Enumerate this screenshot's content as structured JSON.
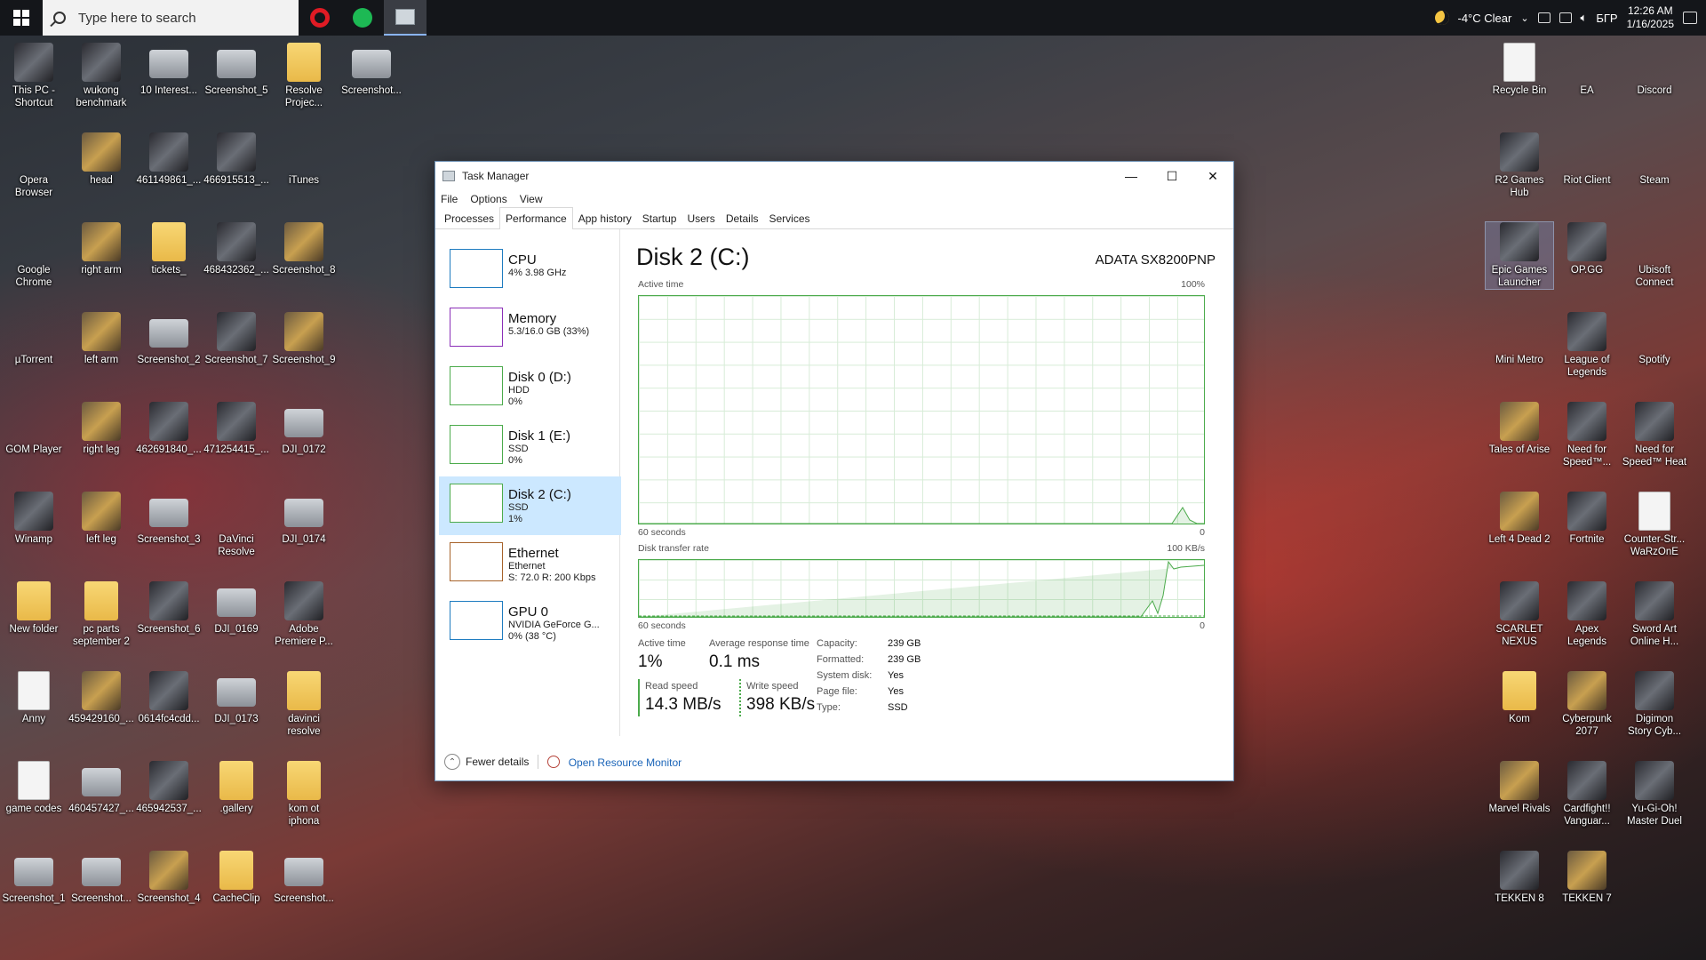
{
  "taskbar": {
    "search_placeholder": "Type here to search",
    "weather": "-4°C  Clear",
    "language": "БГР",
    "time": "12:26 AM",
    "date": "1/16/2025"
  },
  "desktop_left": [
    {
      "label": "This PC -\nShortcut",
      "icon": "pc-icon",
      "style": "dark"
    },
    {
      "label": "wukong\nbenchmark",
      "icon": "image-icon",
      "style": "dark"
    },
    {
      "label": "10 Interest...",
      "icon": "screenshot-icon",
      "style": "shot"
    },
    {
      "label": "Screenshot_5",
      "icon": "screenshot-icon",
      "style": "shot"
    },
    {
      "label": "Resolve\nProjec...",
      "icon": "folder-icon",
      "style": "folder"
    },
    {
      "label": "Screenshot...",
      "icon": "screenshot-icon",
      "style": "shot"
    },
    {
      "label": "Opera\nBrowser",
      "icon": "opera-icon",
      "style": "circle"
    },
    {
      "label": "head",
      "icon": "image-icon",
      "style": "photo"
    },
    {
      "label": "461149861_...",
      "icon": "image-icon",
      "style": "dark"
    },
    {
      "label": "466915513_...",
      "icon": "image-icon",
      "style": "dark"
    },
    {
      "label": "iTunes",
      "icon": "itunes-icon",
      "style": "circle"
    },
    {
      "label": "Google\nChrome",
      "icon": "chrome-icon",
      "style": "circle"
    },
    {
      "label": "right arm",
      "icon": "image-icon",
      "style": "photo"
    },
    {
      "label": "tickets_",
      "icon": "folder-icon",
      "style": "folder"
    },
    {
      "label": "468432362_...",
      "icon": "image-icon",
      "style": "dark"
    },
    {
      "label": "Screenshot_8",
      "icon": "image-icon",
      "style": "photo"
    },
    {
      "label": "µTorrent",
      "icon": "utorrent-icon",
      "style": "circle"
    },
    {
      "label": "left arm",
      "icon": "image-icon",
      "style": "photo"
    },
    {
      "label": "Screenshot_2",
      "icon": "screenshot-icon",
      "style": "shot"
    },
    {
      "label": "Screenshot_7",
      "icon": "image-icon",
      "style": "dark"
    },
    {
      "label": "Screenshot_9",
      "icon": "image-icon",
      "style": "photo"
    },
    {
      "label": "GOM Player",
      "icon": "gom-icon",
      "style": "circle"
    },
    {
      "label": "right leg",
      "icon": "image-icon",
      "style": "photo"
    },
    {
      "label": "462691840_...",
      "icon": "image-icon",
      "style": "dark"
    },
    {
      "label": "471254415_...",
      "icon": "image-icon",
      "style": "dark"
    },
    {
      "label": "DJI_0172",
      "icon": "screenshot-icon",
      "style": "shot"
    },
    {
      "label": "Winamp",
      "icon": "winamp-icon",
      "style": "dark"
    },
    {
      "label": "left leg",
      "icon": "image-icon",
      "style": "photo"
    },
    {
      "label": "Screenshot_3",
      "icon": "screenshot-icon",
      "style": "shot"
    },
    {
      "label": "DaVinci\nResolve",
      "icon": "davinci-icon",
      "style": "circle"
    },
    {
      "label": "DJI_0174",
      "icon": "screenshot-icon",
      "style": "shot"
    },
    {
      "label": "New folder",
      "icon": "folder-icon",
      "style": "folder"
    },
    {
      "label": "pc parts\nseptember 2",
      "icon": "folder-icon",
      "style": "folder"
    },
    {
      "label": "Screenshot_6",
      "icon": "image-icon",
      "style": "dark"
    },
    {
      "label": "DJI_0169",
      "icon": "screenshot-icon",
      "style": "shot"
    },
    {
      "label": "Adobe\nPremiere P...",
      "icon": "premiere-icon",
      "style": "dark"
    },
    {
      "label": "Anny",
      "icon": "pdf-icon",
      "style": "doc"
    },
    {
      "label": "459429160_...",
      "icon": "image-icon",
      "style": "photo"
    },
    {
      "label": "0614fc4cdd...",
      "icon": "image-icon",
      "style": "dark"
    },
    {
      "label": "DJI_0173",
      "icon": "screenshot-icon",
      "style": "shot"
    },
    {
      "label": "davinci\nresolve",
      "icon": "folder-icon",
      "style": "folder"
    },
    {
      "label": "game codes",
      "icon": "document-icon",
      "style": "doc"
    },
    {
      "label": "460457427_...",
      "icon": "screenshot-icon",
      "style": "shot"
    },
    {
      "label": "465942537_...",
      "icon": "image-icon",
      "style": "dark"
    },
    {
      "label": ".gallery",
      "icon": "folder-icon",
      "style": "folder"
    },
    {
      "label": "kom ot\niphona",
      "icon": "folder-icon",
      "style": "folder"
    },
    {
      "label": "Screenshot_1",
      "icon": "screenshot-icon",
      "style": "shot"
    },
    {
      "label": "Screenshot...",
      "icon": "screenshot-icon",
      "style": "shot"
    },
    {
      "label": "Screenshot_4",
      "icon": "image-icon",
      "style": "photo"
    },
    {
      "label": "CacheClip",
      "icon": "folder-icon",
      "style": "folder"
    },
    {
      "label": "Screenshot...",
      "icon": "screenshot-icon",
      "style": "shot"
    }
  ],
  "desktop_right": [
    {
      "label": "Recycle Bin",
      "icon": "recycle-bin-icon",
      "style": "doc"
    },
    {
      "label": "EA",
      "icon": "ea-icon",
      "style": "circle"
    },
    {
      "label": "Discord",
      "icon": "discord-icon",
      "style": "circle"
    },
    {
      "label": "R2 Games\nHub",
      "icon": "r2-games-icon",
      "style": "dark"
    },
    {
      "label": "Riot Client",
      "icon": "riot-icon",
      "style": "circle"
    },
    {
      "label": "Steam",
      "icon": "steam-icon",
      "style": "circle"
    },
    {
      "label": "Epic Games\nLauncher",
      "icon": "epic-icon",
      "style": "dark"
    },
    {
      "label": "OP.GG",
      "icon": "opgg-icon",
      "style": "dark"
    },
    {
      "label": "Ubisoft\nConnect",
      "icon": "ubisoft-icon",
      "style": "circle"
    },
    {
      "label": "Mini Metro",
      "icon": "minimetro-icon",
      "style": "circle"
    },
    {
      "label": "League of\nLegends",
      "icon": "lol-icon",
      "style": "dark"
    },
    {
      "label": "Spotify",
      "icon": "spotify-icon",
      "style": "circle"
    },
    {
      "label": "Tales of Arise",
      "icon": "game-icon",
      "style": "photo"
    },
    {
      "label": "Need for\nSpeed™...",
      "icon": "game-icon",
      "style": "dark"
    },
    {
      "label": "Need for\nSpeed™ Heat",
      "icon": "game-icon",
      "style": "dark"
    },
    {
      "label": "Left 4 Dead 2",
      "icon": "game-icon",
      "style": "photo"
    },
    {
      "label": "Fortnite",
      "icon": "fortnite-icon",
      "style": "dark"
    },
    {
      "label": "Counter-Str...\nWaRzOnE",
      "icon": "game-icon",
      "style": "doc"
    },
    {
      "label": "SCARLET\nNEXUS",
      "icon": "game-icon",
      "style": "dark"
    },
    {
      "label": "Apex\nLegends",
      "icon": "apex-icon",
      "style": "dark"
    },
    {
      "label": "Sword Art\nOnline H...",
      "icon": "game-icon",
      "style": "dark"
    },
    {
      "label": "Kom",
      "icon": "folder-icon",
      "style": "folder"
    },
    {
      "label": "Cyberpunk\n2077",
      "icon": "game-icon",
      "style": "photo"
    },
    {
      "label": "Digimon\nStory Cyb...",
      "icon": "game-icon",
      "style": "dark"
    },
    {
      "label": "Marvel Rivals",
      "icon": "game-icon",
      "style": "photo"
    },
    {
      "label": "Cardfight!!\nVanguar...",
      "icon": "game-icon",
      "style": "dark"
    },
    {
      "label": "Yu-Gi-Oh!\nMaster Duel",
      "icon": "game-icon",
      "style": "dark"
    },
    {
      "label": "TEKKEN 8",
      "icon": "game-icon",
      "style": "dark"
    },
    {
      "label": "TEKKEN 7",
      "icon": "game-icon",
      "style": "photo"
    }
  ],
  "taskmanager": {
    "title": "Task Manager",
    "menu": [
      "File",
      "Options",
      "View"
    ],
    "tabs": [
      "Processes",
      "Performance",
      "App history",
      "Startup",
      "Users",
      "Details",
      "Services"
    ],
    "active_tab": "Performance",
    "sidebar": [
      {
        "name": "CPU",
        "sub1": "4%  3.98 GHz",
        "sub2": "",
        "color": "#1e7cc0"
      },
      {
        "name": "Memory",
        "sub1": "5.3/16.0 GB (33%)",
        "sub2": "",
        "color": "#8b2fb8"
      },
      {
        "name": "Disk 0 (D:)",
        "sub1": "HDD",
        "sub2": "0%",
        "color": "#4cab4c"
      },
      {
        "name": "Disk 1 (E:)",
        "sub1": "SSD",
        "sub2": "0%",
        "color": "#4cab4c"
      },
      {
        "name": "Disk 2 (C:)",
        "sub1": "SSD",
        "sub2": "1%",
        "color": "#4cab4c"
      },
      {
        "name": "Ethernet",
        "sub1": "Ethernet",
        "sub2": "S: 72.0  R: 200 Kbps",
        "color": "#a7632a"
      },
      {
        "name": "GPU 0",
        "sub1": "NVIDIA GeForce G...",
        "sub2": "0% (38 °C)",
        "color": "#1e7cc0"
      }
    ],
    "selected_index": 4,
    "disk_title": "Disk 2 (C:)",
    "disk_model": "ADATA SX8200PNP",
    "active_time_label": "Active time",
    "active_time_max": "100%",
    "seconds_label": "60 seconds",
    "zero": "0",
    "transfer_label": "Disk transfer rate",
    "transfer_max": "100 KB/s",
    "stats": {
      "active_time_label": "Active time",
      "active_time_value": "1%",
      "avg_response_label": "Average response time",
      "avg_response_value": "0.1 ms",
      "read_label": "Read speed",
      "read_value": "14.3 MB/s",
      "write_label": "Write speed",
      "write_value": "398 KB/s"
    },
    "properties": [
      {
        "k": "Capacity:",
        "v": "239 GB"
      },
      {
        "k": "Formatted:",
        "v": "239 GB"
      },
      {
        "k": "System disk:",
        "v": "Yes"
      },
      {
        "k": "Page file:",
        "v": "Yes"
      },
      {
        "k": "Type:",
        "v": "SSD"
      }
    ],
    "fewer_details": "Fewer details",
    "open_resource_monitor": "Open Resource Monitor"
  },
  "colors": {
    "disk_green": "#4cab4c",
    "selected_bg": "#cce8ff",
    "link": "#1a64b8"
  }
}
